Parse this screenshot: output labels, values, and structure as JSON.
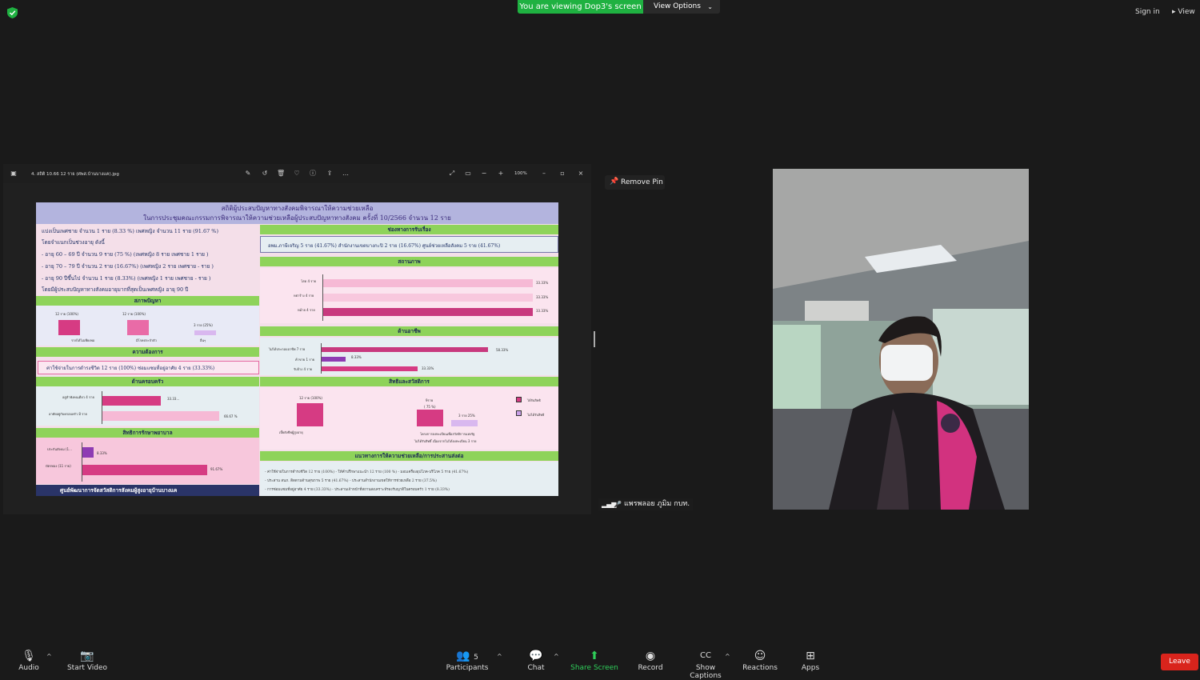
{
  "top": {
    "banner": "You are viewing Dop3's screen",
    "view_options": "View Options",
    "sign_in": "Sign in",
    "view": "View"
  },
  "viewer": {
    "file_name": "4. สถิติ 10.66 12 ราย (ศพส.บ้านบางแค).jpg",
    "zoom": "100%"
  },
  "slide": {
    "title_1": "สถิติผู้ประสบปัญหาทางสังคมพิจารณาให้ความช่วยเหลือ",
    "title_2": "ในการประชุมคณะกรรมการพิจารณาให้ความช่วยเหลือผู้ประสบปัญหาทางสังคม ครั้งที่ 10/2566 จำนวน 12 ราย",
    "intro": [
      "แบ่งเป็นเพศชาย จำนวน 1 ราย (8.33 %) เพศหญิง จำนวน 11 ราย (91.67 %)",
      "โดยจำแนกเป็นช่วงอายุ ดังนี้",
      "-  อายุ 60 – 69 ปี จำนวน 9 ราย (75 %) (เพศหญิง 8 ราย เพศชาย 1 ราย )",
      "-  อายุ 70 – 79 ปี จำนวน 2 ราย (16.67%) (เพศหญิง 2 ราย เพศชาย - ราย )",
      "-  อายุ 90 ปีขึ้นไป จำนวน 1 ราย (8.33%) (เพศหญิง 1 ราย เพศชาย - ราย )",
      "โดยมีผู้ประสบปัญหาทางสังคมอายุมากที่สุดเป็นเพศหญิง อายุ 90 ปี"
    ],
    "problem_header": "สภาพปัญหา",
    "problem_labels": [
      "12 ราย (100%)",
      "12 ราย (100%)",
      "3 ราย (25%)"
    ],
    "problem_legend": [
      "รายได้ไม่เพียงพอ",
      "มีโรคประจำตัว",
      "อื่นๆ"
    ],
    "needs_header": "ความต้องการ",
    "needs_text": "ค่าใช้จ่ายในการดำรงชีวิต 12 ราย (100%)  ซ่อมแซมที่อยู่อาศัย 4 ราย (33.33%)",
    "family_header": "ด้านครอบครัว",
    "family_rows": [
      {
        "label": "อยู่ลำพังคนเดียว 4 ราย",
        "value": "33.33..."
      },
      {
        "label": "อาศัยอยู่กับครอบครัว 8 ราย",
        "value": "66.67 %"
      }
    ],
    "health_header": "สิทธิการรักษาพยาบาล",
    "health_rows": [
      {
        "label": "ประกันสังคม (1...",
        "value": "8.33%"
      },
      {
        "label": "บัตรทอง (11 ราย)",
        "value": "91.67%"
      }
    ],
    "footer": "ศูนย์พัฒนาการจัดสวัสดิการสังคมผู้สูงอายุบ้านบางแค",
    "channel_header": "ช่องทางการรับเรื่อง",
    "channel_text": "อพม.ภาษีเจริญ 5 ราย (41.67%)   สำนักงานเขตบางกะปิ 2 ราย (16.67%)  ศูนย์ช่วยเหลือสังคม 5 ราย (41.67%)",
    "status_header": "สถานภาพ",
    "status_rows": [
      {
        "label": "โสด 4 ราย",
        "value": "33.33%"
      },
      {
        "label": "หย่าร้าง 4 ราย",
        "value": "33.33%"
      },
      {
        "label": "หม้าย 4 ราย",
        "value": "33.33%"
      }
    ],
    "career_header": "ด้านอาชีพ",
    "career_rows": [
      {
        "label": "ไม่ได้ประกอบอาชีพ 7 ราย",
        "value": "58.33%"
      },
      {
        "label": "ค้าขาย 1 ราย",
        "value": "8.33%"
      },
      {
        "label": "รับจ้าง 4 ราย",
        "value": "33.33%"
      }
    ],
    "rights_header": "สิทธิและสวัสดิการ",
    "rights_labels": [
      "12 ราย (100%)",
      "9ราย",
      "( 75 %)",
      "3 ราย 25%"
    ],
    "rights_x": [
      "เบี้ยยังชีพผู้สูงอายุ",
      "โครงการลงทะเบียนเพื่อสวัสดิการแห่งรัฐ",
      "ไม่ได้รับสิทธิ์  เนื่องจากไม่ได้ลงทะเบียน 3 ราย"
    ],
    "rights_legend": [
      "ได้รับสิทธิ",
      "ไม่ได้รับสิทธิ"
    ],
    "guide_header": "แนวทางการให้ความช่วยเหลือ/การประสานส่งต่อ",
    "guide_lines": [
      "- ค่าใช้จ่ายในการดำรงชีวิต  12 ราย (100%)      - ให้คำปรึกษาแนะนำ 12 ราย (100 %)    - มอบเครื่องอุปโภค-บริโภค  5 ราย (41.67%)",
      "- ประสาน สนภ. ติดตามด้านสุขภาพ 5 ราย (41.67%)     - ประสานสำนักงานเขตให้การช่วยเหลือ 2 ราย (37.5%)",
      "- การซ่อมแซมที่อยู่อาศัย  4 ราย (33.33%)               - ประสานเจ้าหน้าที่สถานสงเคราะห์รองรับญาติในครอบครัว  1 ราย (8.33%)"
    ],
    "colors": {
      "dark_pink": "#d63b83",
      "mid_pink": "#e96ba7",
      "light_pink": "#f6b9d5",
      "lavender": "#c9a0e8",
      "green": "#8ed35a"
    }
  },
  "panel": {
    "remove_pin": "Remove Pin",
    "participant_name": "แพรพลอย ภูมิม กบท."
  },
  "bottom": {
    "audio": "Audio",
    "start_video": "Start Video",
    "participants": "Participants",
    "participants_count": "5",
    "chat": "Chat",
    "share_screen": "Share Screen",
    "record": "Record",
    "show_captions": "Show Captions",
    "reactions": "Reactions",
    "apps": "Apps",
    "leave": "Leave"
  }
}
